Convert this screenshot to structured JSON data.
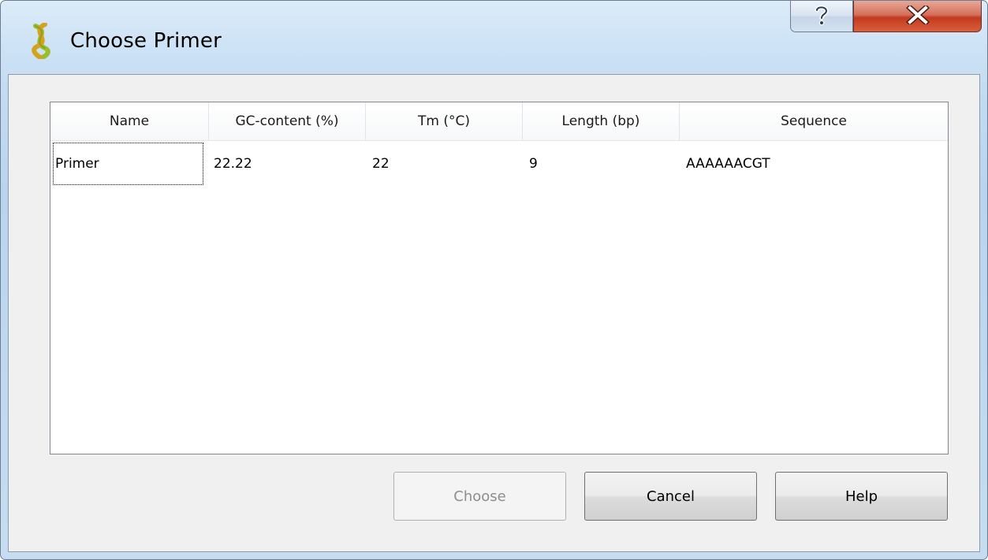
{
  "window": {
    "title": "Choose Primer",
    "help_glyph": "?",
    "close_glyph": "X"
  },
  "table": {
    "columns": [
      "Name",
      "GC-content (%)",
      "Tm (°C)",
      "Length (bp)",
      "Sequence"
    ],
    "rows": [
      {
        "name": "Primer",
        "gc_content": "22.22",
        "tm": "22",
        "length": "9",
        "sequence": "AAAAAACGT"
      }
    ]
  },
  "buttons": {
    "choose": "Choose",
    "cancel": "Cancel",
    "help": "Help"
  },
  "icons": {
    "app": "dna-helix-icon",
    "help": "question-mark-icon",
    "close": "close-icon"
  },
  "colors": {
    "close_button": "#c23a1f",
    "title_bar": "#cde2f5",
    "client_background": "#f0f0f0"
  }
}
